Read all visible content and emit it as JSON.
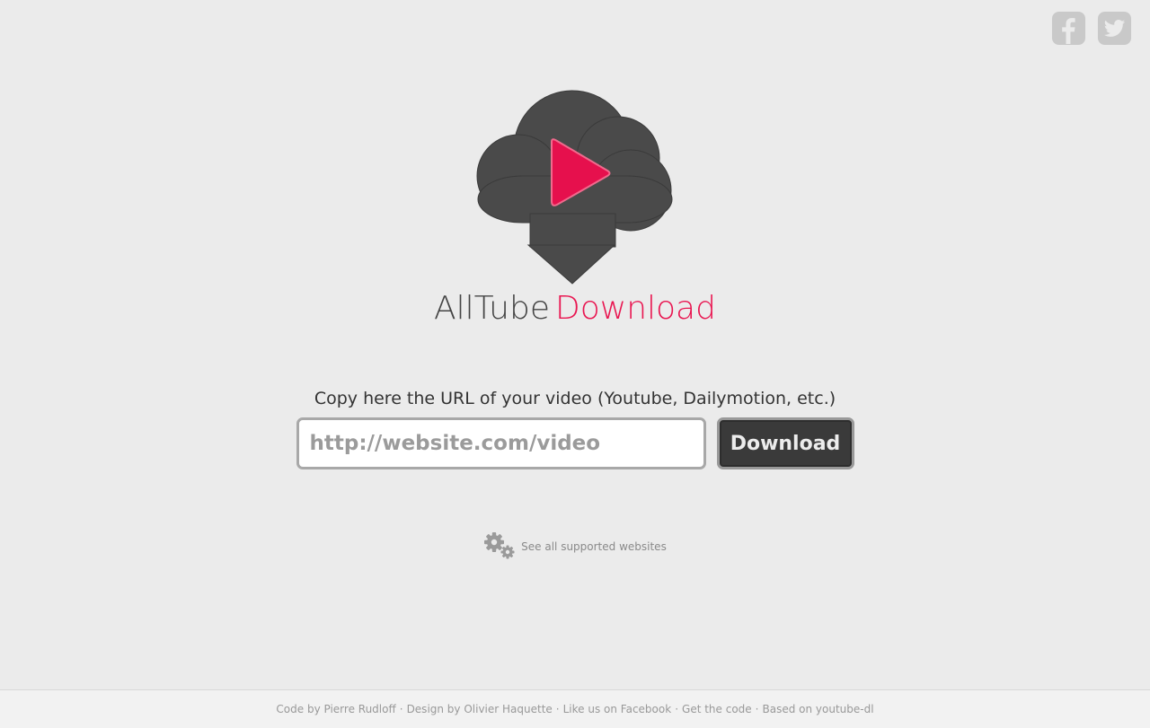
{
  "social": {
    "facebook_icon": "facebook-square-icon",
    "twitter_icon": "twitter-square-icon"
  },
  "logo": {
    "word1": "AllTube",
    "word2": "Download",
    "cloud_color": "#4a4a4a",
    "accent_color": "#e91550"
  },
  "form": {
    "label": "Copy here the URL of your video (Youtube, Dailymotion, etc.)",
    "input_placeholder": "http://website.com/video",
    "input_value": "",
    "button_label": "Download"
  },
  "supported": {
    "icon": "gears-icon",
    "link_label": "See all supported websites"
  },
  "footer": {
    "code_by": "Code by Pierre Rudloff",
    "design_by": "Design by Olivier Haquette",
    "like_us": "Like us on Facebook",
    "get_code": "Get the code",
    "based_on": "Based on youtube-dl",
    "separator": "·"
  }
}
